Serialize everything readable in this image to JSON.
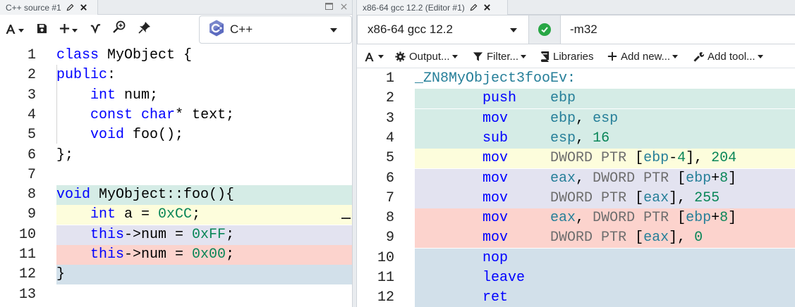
{
  "left_pane": {
    "tab": {
      "title": "C++ source #1"
    },
    "language": {
      "label": "C++"
    },
    "source_lines": [
      {
        "n": "1",
        "text": "class MyObject {",
        "bg": ""
      },
      {
        "n": "2",
        "text": "public:",
        "bg": ""
      },
      {
        "n": "3",
        "text": "    int num;",
        "bg": ""
      },
      {
        "n": "4",
        "text": "    const char* text;",
        "bg": ""
      },
      {
        "n": "5",
        "text": "    void foo();",
        "bg": ""
      },
      {
        "n": "6",
        "text": "};",
        "bg": ""
      },
      {
        "n": "7",
        "text": "",
        "bg": ""
      },
      {
        "n": "8",
        "text": "void MyObject::foo(){",
        "bg": "#d5ece6"
      },
      {
        "n": "9",
        "text": "    int a = 0xCC;",
        "bg": "#fdfddc"
      },
      {
        "n": "10",
        "text": "    this->num = 0xFF;",
        "bg": "#e3e3f0"
      },
      {
        "n": "11",
        "text": "    this->num = 0x00;",
        "bg": "#fcd3cd"
      },
      {
        "n": "12",
        "text": "}",
        "bg": "#d2e0ea"
      },
      {
        "n": "13",
        "text": "",
        "bg": ""
      }
    ]
  },
  "right_pane": {
    "tab": {
      "title": "x86-64 gcc 12.2 (Editor #1)"
    },
    "compiler": {
      "label": "x86-64 gcc 12.2"
    },
    "flags": {
      "value": "-m32"
    },
    "toolbar": {
      "output": "Output...",
      "filter": "Filter...",
      "libraries": "Libraries",
      "add_new": "Add new...",
      "add_tool": "Add tool..."
    },
    "asm_lines": [
      {
        "n": "1",
        "text": "_ZN8MyObject3fooEv:",
        "bg": ""
      },
      {
        "n": "2",
        "text": "        push    ebp",
        "bg": "#d5ece6"
      },
      {
        "n": "3",
        "text": "        mov     ebp, esp",
        "bg": "#d5ece6"
      },
      {
        "n": "4",
        "text": "        sub     esp, 16",
        "bg": "#d5ece6"
      },
      {
        "n": "5",
        "text": "        mov     DWORD PTR [ebp-4], 204",
        "bg": "#fdfddc"
      },
      {
        "n": "6",
        "text": "        mov     eax, DWORD PTR [ebp+8]",
        "bg": "#e3e3f0"
      },
      {
        "n": "7",
        "text": "        mov     DWORD PTR [eax], 255",
        "bg": "#e3e3f0"
      },
      {
        "n": "8",
        "text": "        mov     eax, DWORD PTR [ebp+8]",
        "bg": "#fcd3cd"
      },
      {
        "n": "9",
        "text": "        mov     DWORD PTR [eax], 0",
        "bg": "#fcd3cd"
      },
      {
        "n": "10",
        "text": "        nop",
        "bg": "#d2e0ea"
      },
      {
        "n": "11",
        "text": "        leave",
        "bg": "#d2e0ea"
      },
      {
        "n": "12",
        "text": "        ret",
        "bg": "#d2e0ea"
      }
    ]
  },
  "icons": {
    "edit": "pencil-icon",
    "close": "close-icon",
    "maximize": "maximize-icon",
    "font": "font-size-icon",
    "save": "save-icon",
    "add": "add-icon",
    "vim": "vim-icon",
    "search": "zoom-search-icon",
    "pin": "pin-icon",
    "cpp_logo": "cpp-logo-icon",
    "status_ok": "check-circle-icon"
  }
}
